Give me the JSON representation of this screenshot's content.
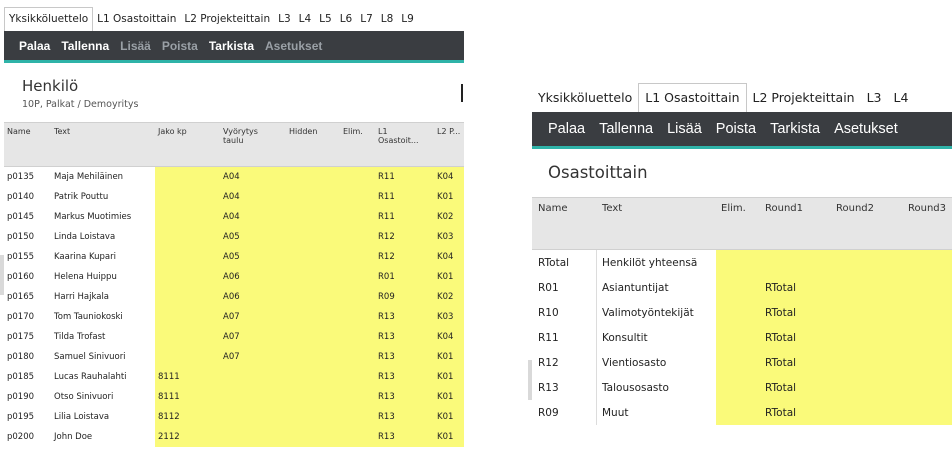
{
  "left": {
    "tabs": [
      "Yksikköluettelo",
      "L1 Osastoittain",
      "L2 Projekteittain",
      "L3",
      "L4",
      "L5",
      "L6",
      "L7",
      "L8",
      "L9"
    ],
    "active_tab": 0,
    "toolbar": {
      "palaa": "Palaa",
      "tallenna": "Tallenna",
      "lisaa": "Lisää",
      "poista": "Poista",
      "tarkista": "Tarkista",
      "asetukset": "Asetukset"
    },
    "title": "Henkilö",
    "subtitle": "10P, Palkat / Demoyritys",
    "columns": {
      "name": "Name",
      "text": "Text",
      "jako": "Jako kp",
      "vyorytys": "Vyörytys taulu",
      "hidden": "Hidden",
      "elim": "Elim.",
      "l1": "L1 Osastoit...",
      "l2": "L2 P..."
    },
    "rows": [
      {
        "name": "p0135",
        "text": "Maja Mehiläinen",
        "jako": "",
        "vyor": "A04",
        "l1": "R11",
        "l2": "K04"
      },
      {
        "name": "p0140",
        "text": "Patrik Pouttu",
        "jako": "",
        "vyor": "A04",
        "l1": "R11",
        "l2": "K01"
      },
      {
        "name": "p0145",
        "text": "Markus Muotimies",
        "jako": "",
        "vyor": "A04",
        "l1": "R11",
        "l2": "K02"
      },
      {
        "name": "p0150",
        "text": "Linda Loistava",
        "jako": "",
        "vyor": "A05",
        "l1": "R12",
        "l2": "K03"
      },
      {
        "name": "p0155",
        "text": "Kaarina Kupari",
        "jako": "",
        "vyor": "A05",
        "l1": "R12",
        "l2": "K04"
      },
      {
        "name": "p0160",
        "text": "Helena Huippu",
        "jako": "",
        "vyor": "A06",
        "l1": "R01",
        "l2": "K01"
      },
      {
        "name": "p0165",
        "text": "Harri Hajkala",
        "jako": "",
        "vyor": "A06",
        "l1": "R09",
        "l2": "K02"
      },
      {
        "name": "p0170",
        "text": "Tom Tauniokoski",
        "jako": "",
        "vyor": "A07",
        "l1": "R13",
        "l2": "K03"
      },
      {
        "name": "p0175",
        "text": "Tilda Trofast",
        "jako": "",
        "vyor": "A07",
        "l1": "R13",
        "l2": "K04"
      },
      {
        "name": "p0180",
        "text": "Samuel Sinivuori",
        "jako": "",
        "vyor": "A07",
        "l1": "R13",
        "l2": "K01"
      },
      {
        "name": "p0185",
        "text": "Lucas Rauhalahti",
        "jako": "8111",
        "vyor": "",
        "l1": "R13",
        "l2": "K01"
      },
      {
        "name": "p0190",
        "text": "Otso Sinivuori",
        "jako": "8111",
        "vyor": "",
        "l1": "R13",
        "l2": "K01"
      },
      {
        "name": "p0195",
        "text": "Lilia Loistava",
        "jako": "8112",
        "vyor": "",
        "l1": "R13",
        "l2": "K01"
      },
      {
        "name": "p0200",
        "text": "John Doe",
        "jako": "2112",
        "vyor": "",
        "l1": "R13",
        "l2": "K01"
      }
    ]
  },
  "right": {
    "tabs": [
      "Yksikköluettelo",
      "L1 Osastoittain",
      "L2 Projekteittain",
      "L3",
      "L4"
    ],
    "active_tab": 1,
    "toolbar": {
      "palaa": "Palaa",
      "tallenna": "Tallenna",
      "lisaa": "Lisää",
      "poista": "Poista",
      "tarkista": "Tarkista",
      "asetukset": "Asetukset"
    },
    "title": "Osastoittain",
    "columns": {
      "name": "Name",
      "text": "Text",
      "elim": "Elim.",
      "round1": "Round1",
      "round2": "Round2",
      "round3": "Round3"
    },
    "rows": [
      {
        "name": "RTotal",
        "text": "Henkilöt yhteensä",
        "round1": ""
      },
      {
        "name": "R01",
        "text": "Asiantuntijat",
        "round1": "RTotal"
      },
      {
        "name": "R10",
        "text": "Valimotyöntekijät",
        "round1": "RTotal"
      },
      {
        "name": "R11",
        "text": "Konsultit",
        "round1": "RTotal"
      },
      {
        "name": "R12",
        "text": "Vientiosasto",
        "round1": "RTotal"
      },
      {
        "name": "R13",
        "text": "Talousosasto",
        "round1": "RTotal"
      },
      {
        "name": "R09",
        "text": "Muut",
        "round1": "RTotal"
      }
    ]
  },
  "colors": {
    "toolbar_bg": "#3a3d41",
    "accent": "#2fb3a8",
    "highlight": "#fafa7a",
    "header_bg": "#e6e6e6"
  }
}
